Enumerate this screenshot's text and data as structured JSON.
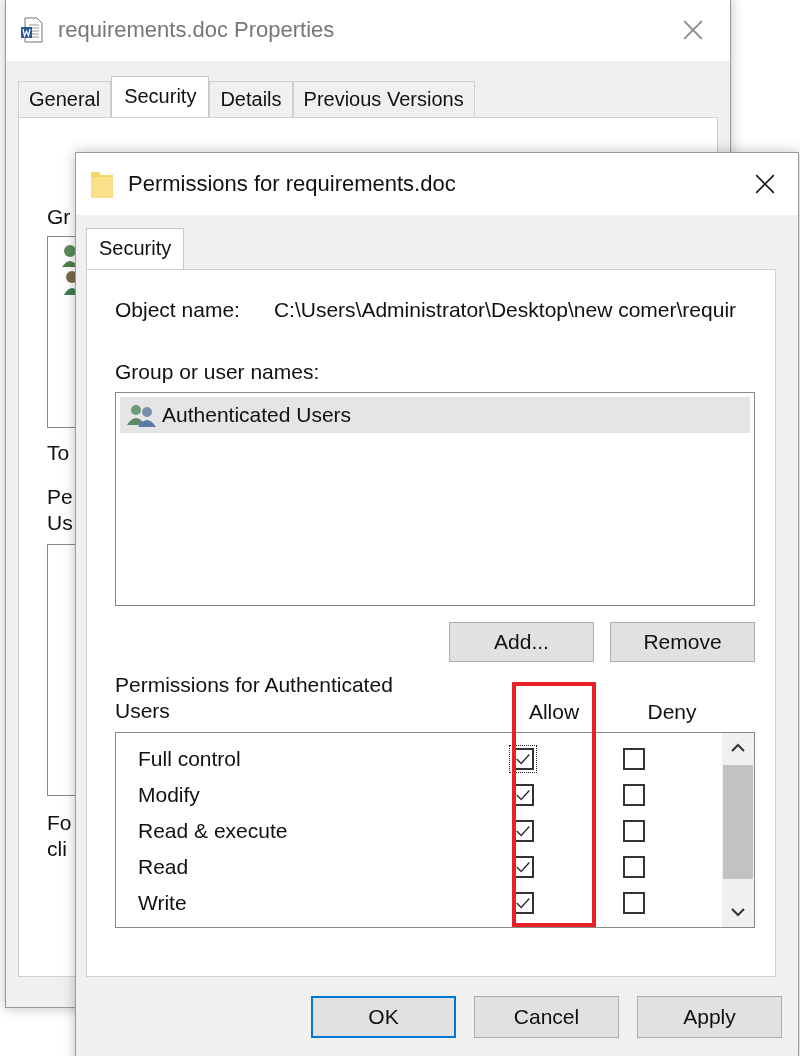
{
  "back_window": {
    "title": "requirements.doc Properties",
    "tabs": [
      {
        "label": "General",
        "selected": false
      },
      {
        "label": "Security",
        "selected": true
      },
      {
        "label": "Details",
        "selected": false
      },
      {
        "label": "Previous Versions",
        "selected": false
      }
    ],
    "group_label": "Gr",
    "to_label": "To",
    "perm_label_lines": [
      "Pe",
      "Us"
    ],
    "footer_lines": [
      "Fo",
      "cli"
    ]
  },
  "front_window": {
    "title": "Permissions for requirements.doc",
    "tabs": [
      {
        "label": "Security",
        "selected": true
      }
    ],
    "object_name_label": "Object name:",
    "object_name_value": "C:\\Users\\Administrator\\Desktop\\new comer\\requir",
    "group_label": "Group or user names:",
    "users": [
      {
        "name": "Authenticated Users",
        "selected": true
      }
    ],
    "user_buttons": [
      "Add...",
      "Remove"
    ],
    "permissions_label": "Permissions for Authenticated Users",
    "columns": [
      "Allow",
      "Deny"
    ],
    "permissions": [
      {
        "name": "Full control",
        "allow": true,
        "deny": false,
        "focused": true
      },
      {
        "name": "Modify",
        "allow": true,
        "deny": false,
        "focused": false
      },
      {
        "name": "Read & execute",
        "allow": true,
        "deny": false,
        "focused": false
      },
      {
        "name": "Read",
        "allow": true,
        "deny": false,
        "focused": false
      },
      {
        "name": "Write",
        "allow": true,
        "deny": false,
        "focused": false
      }
    ],
    "buttons": [
      {
        "label": "OK",
        "default": true
      },
      {
        "label": "Cancel",
        "default": false
      },
      {
        "label": "Apply",
        "default": false
      }
    ]
  }
}
